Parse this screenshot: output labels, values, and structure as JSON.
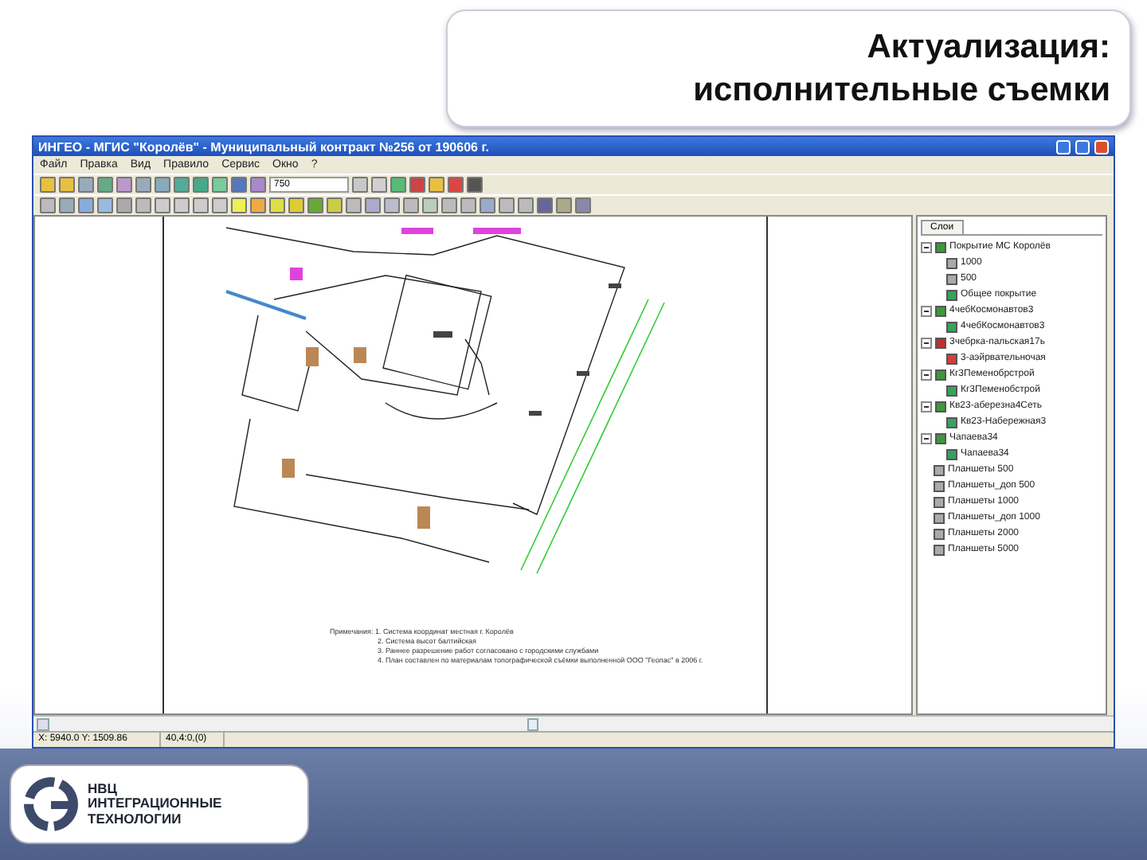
{
  "slide": {
    "title_lines": [
      "Актуализация:",
      "исполнительные съемки"
    ]
  },
  "window": {
    "title": "ИНГЕО - МГИС \"Королёв\" - Муниципальный контракт №256 от 190606 г."
  },
  "menu": [
    "Файл",
    "Правка",
    "Вид",
    "Правило",
    "Сервис",
    "Окно",
    "?"
  ],
  "toolbar": {
    "scale": "750"
  },
  "layers_panel": {
    "tab": "Слои",
    "tree": [
      {
        "label": "Покрытие МС Королёв",
        "kind": "group",
        "expanded": true,
        "children": [
          {
            "label": "1000",
            "kind": "grey"
          },
          {
            "label": "500",
            "kind": "grey"
          },
          {
            "label": "Общее покрытие",
            "kind": "layer"
          }
        ]
      },
      {
        "label": "4чебКосмонавтов3",
        "kind": "group",
        "expanded": true,
        "children": [
          {
            "label": "4чебКосмонавтов3",
            "kind": "layer"
          }
        ]
      },
      {
        "label": "3чебрка-пальская17ь",
        "kind": "redgroup",
        "expanded": true,
        "children": [
          {
            "label": "3-аэйрвательночая",
            "kind": "redlayer"
          }
        ]
      },
      {
        "label": "Кг3Пеменобрстрой",
        "kind": "group",
        "expanded": true,
        "children": [
          {
            "label": "Кг3Пеменобстрой",
            "kind": "layer"
          }
        ]
      },
      {
        "label": "Кв23-аберезна4Сеть",
        "kind": "group",
        "expanded": true,
        "children": [
          {
            "label": "Кв23-Набережная3",
            "kind": "layer"
          }
        ]
      },
      {
        "label": "Чапаева34",
        "kind": "group",
        "expanded": true,
        "children": [
          {
            "label": "Чапаева34",
            "kind": "layer"
          }
        ]
      },
      {
        "label": "Планшеты 500",
        "kind": "grey"
      },
      {
        "label": "Планшеты_доп 500",
        "kind": "grey"
      },
      {
        "label": "Планшеты 1000",
        "kind": "grey"
      },
      {
        "label": "Планшеты_доп 1000",
        "kind": "grey"
      },
      {
        "label": "Планшеты 2000",
        "kind": "grey"
      },
      {
        "label": "Планшеты 5000",
        "kind": "grey"
      }
    ]
  },
  "notes": [
    "Примечания: 1. Система координат местная г. Королёв",
    "2. Система высот балтийская",
    "3. Раннее разрешение работ согласовано с городскими службами",
    "4. План составлен по материалам топографической съёмки выполненной ООО \"Геопас\" в 2006 г."
  ],
  "status_bar": [
    "X: 5940.0 Y: 1509.86",
    "40,4:0,(0)"
  ],
  "logo": {
    "lines": [
      "НВЦ",
      "ИНТЕГРАЦИОННЫЕ",
      "ТЕХНОЛОГИИ"
    ]
  }
}
